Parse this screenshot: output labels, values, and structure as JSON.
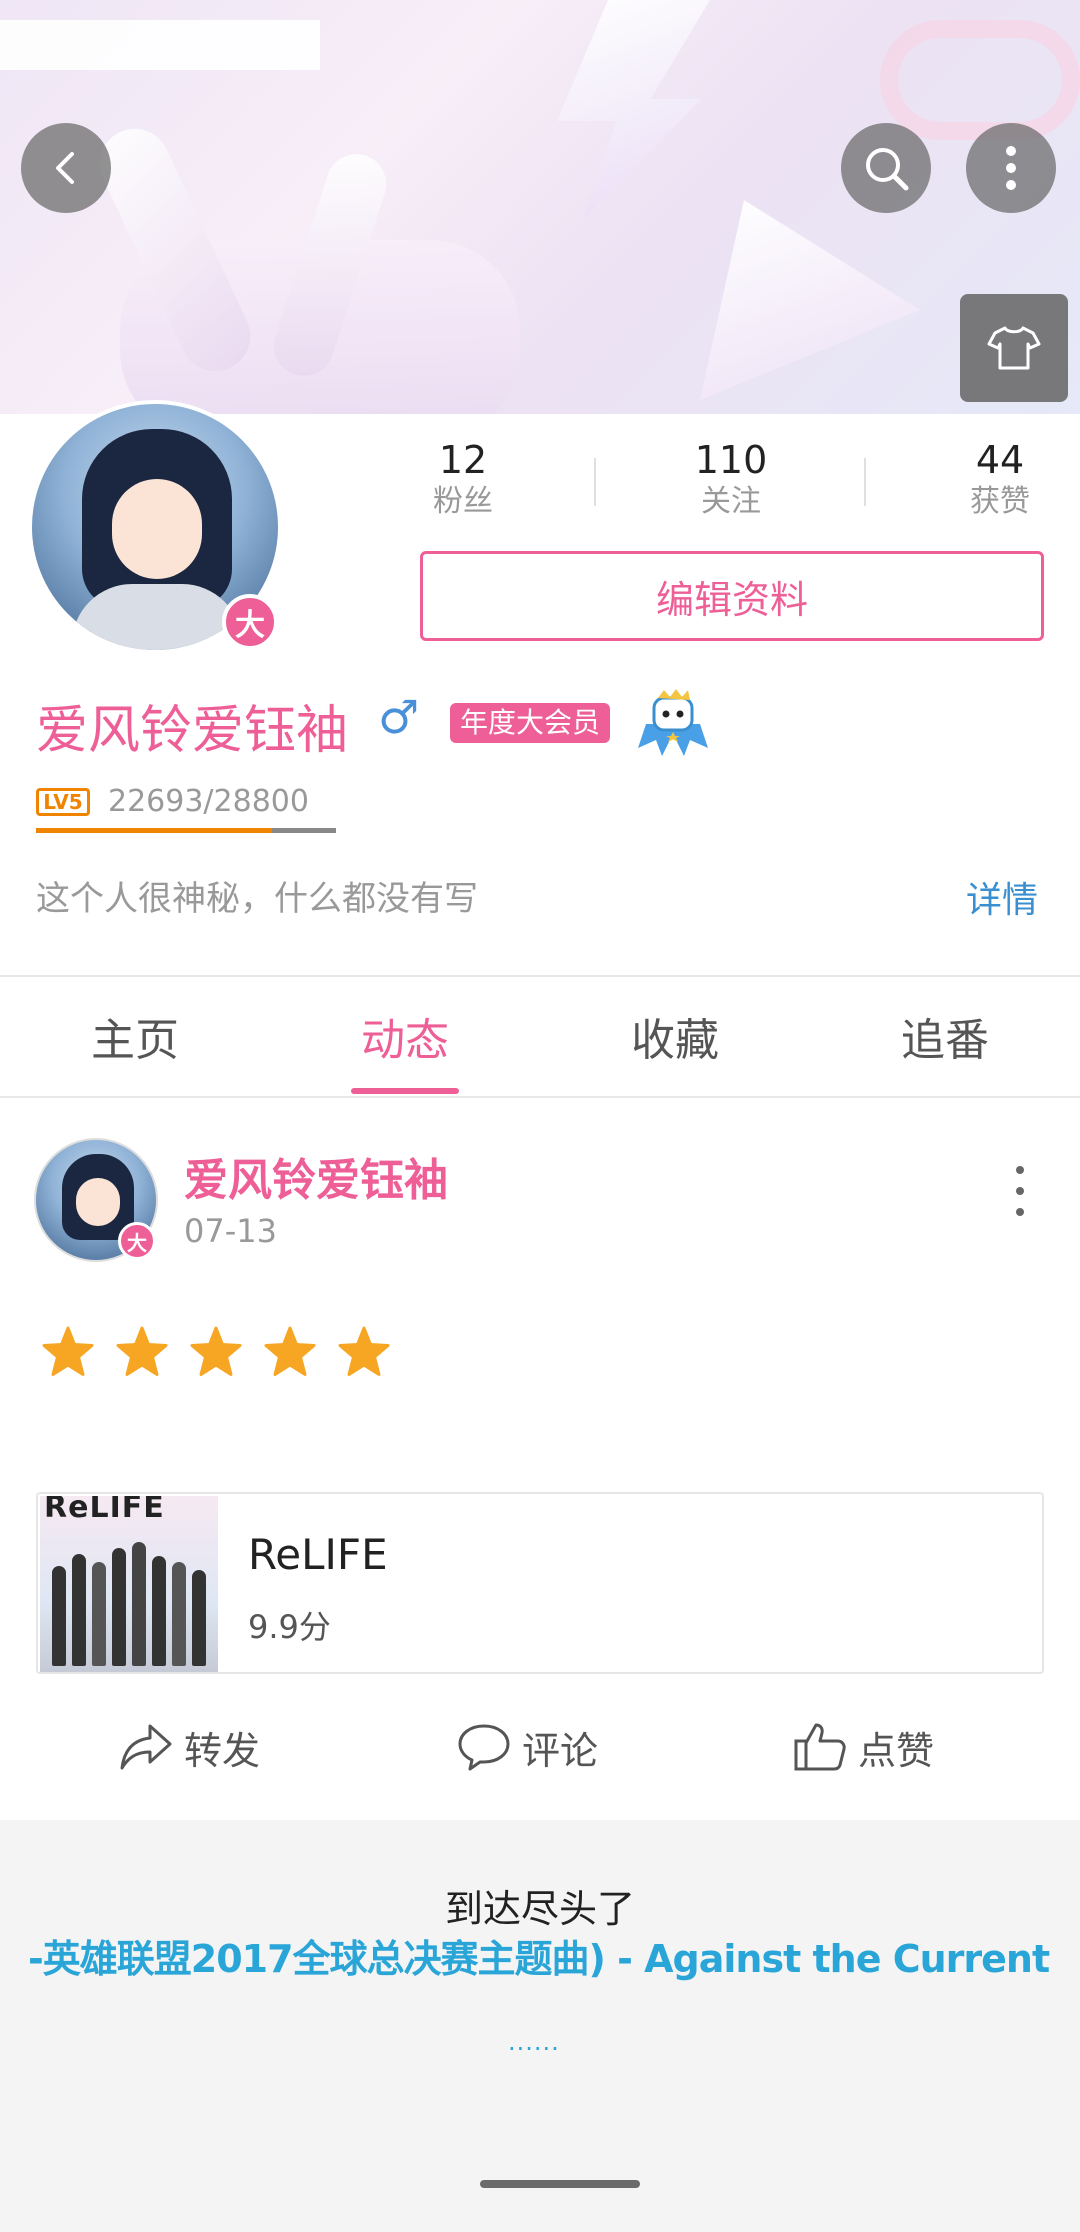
{
  "header": {
    "back_icon": "back-arrow-icon",
    "search_icon": "search-icon",
    "more_icon": "more-vertical-icon",
    "skin_icon": "tshirt-icon"
  },
  "profile": {
    "stats": {
      "fans_count": "12",
      "fans_label": "粉丝",
      "following_count": "110",
      "following_label": "关注",
      "likes_count": "44",
      "likes_label": "获赞"
    },
    "edit_button": "编辑资料",
    "username": "爱风铃爱钰袖",
    "gender": "♂",
    "vip_tag": "年度大会员",
    "avatar_badge": "大",
    "level_tag": "LV5",
    "exp": "22693/28800",
    "exp_progress": 0.788,
    "bio": "这个人很神秘，什么都没有写",
    "detail_link": "详情"
  },
  "tabs": [
    {
      "label": "主页",
      "active": false
    },
    {
      "label": "动态",
      "active": true
    },
    {
      "label": "收藏",
      "active": false
    },
    {
      "label": "追番",
      "active": false
    }
  ],
  "post": {
    "author": "爱风铃爱钰袖",
    "date": "07-13",
    "avatar_badge": "大",
    "rating_stars": 5,
    "anime": {
      "cover_text": "ReLIFE",
      "title": "ReLIFE",
      "score": "9.9分"
    },
    "actions": {
      "share": "转发",
      "comment": "评论",
      "like": "点赞"
    }
  },
  "footer": {
    "end_text": "到达尽头了",
    "lyric": "-英雄联盟2017全球总决赛主题曲) - Against the Current",
    "dots": "......"
  },
  "colors": {
    "accent": "#ee5f97",
    "link": "#3a8fd0",
    "level": "#f08300",
    "star": "#f6a623",
    "lyric": "#2aa5d8"
  }
}
